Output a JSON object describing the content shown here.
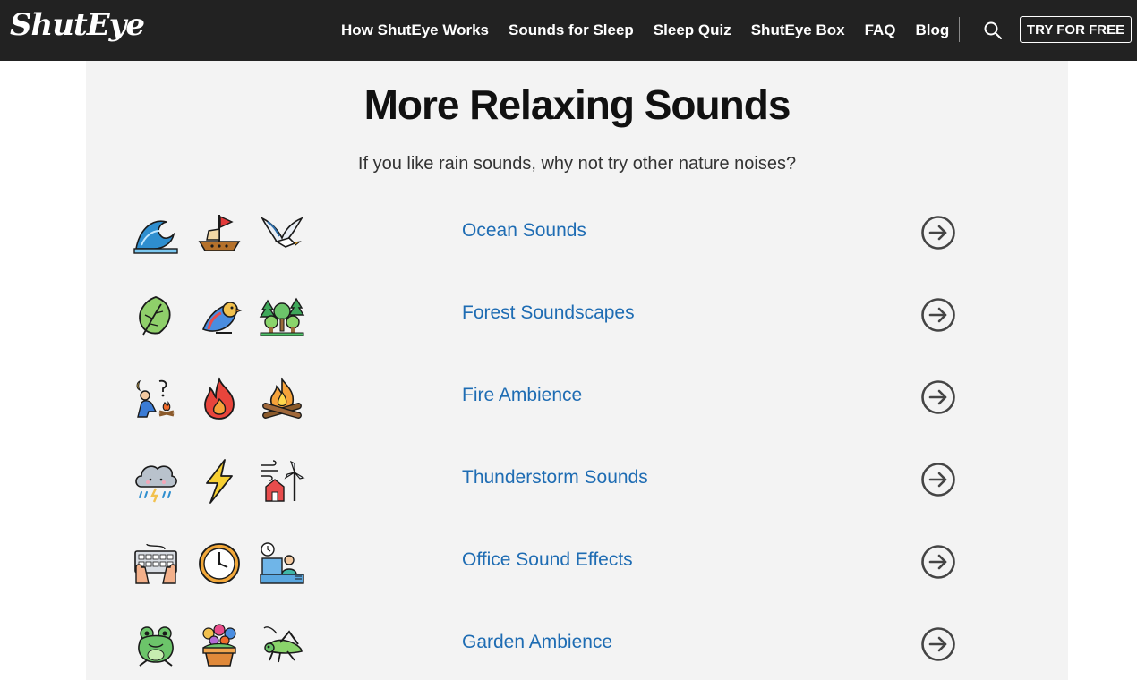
{
  "header": {
    "logo": "ShutEye",
    "nav": [
      "How ShutEye Works",
      "Sounds for Sleep",
      "Sleep Quiz",
      "ShutEye Box",
      "FAQ",
      "Blog"
    ],
    "cta": "TRY FOR FREE"
  },
  "section": {
    "title": "More Relaxing Sounds",
    "subtitle": "If you like rain sounds, why not try other nature noises?",
    "items": [
      {
        "label": "Ocean Sounds",
        "icons": [
          "wave-icon",
          "sailboat-icon",
          "seagull-icon"
        ]
      },
      {
        "label": "Forest Soundscapes",
        "icons": [
          "leaf-icon",
          "bird-icon",
          "trees-icon"
        ]
      },
      {
        "label": "Fire Ambience",
        "icons": [
          "campfire-person-icon",
          "flame-icon",
          "bonfire-icon"
        ]
      },
      {
        "label": "Thunderstorm Sounds",
        "icons": [
          "storm-cloud-icon",
          "lightning-icon",
          "windy-house-icon"
        ]
      },
      {
        "label": "Office Sound Effects",
        "icons": [
          "keyboard-icon",
          "clock-icon",
          "office-worker-icon"
        ]
      },
      {
        "label": "Garden Ambience",
        "icons": [
          "frog-icon",
          "flower-pot-icon",
          "grasshopper-icon"
        ]
      }
    ]
  },
  "colors": {
    "header_bg": "#222222",
    "link": "#1e6cb3",
    "panel_bg": "#f3f3f3"
  }
}
